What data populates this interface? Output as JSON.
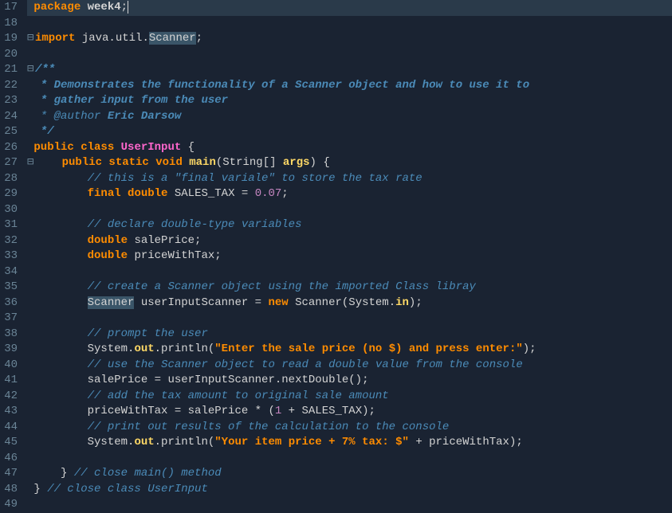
{
  "lineNumbers": [
    "17",
    "18",
    "19",
    "20",
    "21",
    "22",
    "23",
    "24",
    "25",
    "26",
    "27",
    "28",
    "29",
    "30",
    "31",
    "32",
    "33",
    "34",
    "35",
    "36",
    "37",
    "38",
    "39",
    "40",
    "41",
    "42",
    "43",
    "44",
    "45",
    "46",
    "47",
    "48",
    "49"
  ],
  "code": {
    "l17": {
      "kw": "package",
      "pkg": "week4",
      "semi": ";"
    },
    "l19": {
      "kw": "import",
      "pkg": "java.util.",
      "cls": "Scanner",
      "semi": ";"
    },
    "l21": {
      "c": "/**"
    },
    "l22": {
      "c": " * Demonstrates the functionality of a Scanner object and how to use it to"
    },
    "l23": {
      "c": " * gather input from the user"
    },
    "l24": {
      "tag": " * @author ",
      "name": "Eric Darsow"
    },
    "l25": {
      "c": " */"
    },
    "l26": {
      "a": "public ",
      "b": "class ",
      "cls": "UserInput",
      "brace": " {"
    },
    "l27": {
      "a": "public ",
      "b": "static ",
      "c": "void ",
      "m": "main",
      "p1": "(",
      "t": "String",
      "arr": "[] ",
      "arg": "args",
      "p2": ") {"
    },
    "l28": {
      "c": "// this is a \"final variale\" to store the tax rate"
    },
    "l29": {
      "a": "final ",
      "b": "double ",
      "v": "SALES_TAX = ",
      "n": "0.07",
      "s": ";"
    },
    "l31": {
      "c": "// declare double-type variables"
    },
    "l32": {
      "a": "double ",
      "v": "salePrice;"
    },
    "l33": {
      "a": "double ",
      "v": "priceWithTax;"
    },
    "l35": {
      "c": "// create a Scanner object using the imported Class libray"
    },
    "l36": {
      "cls": "Scanner",
      "v1": " userInputScanner = ",
      "kw": "new ",
      "v2": "Scanner(System.",
      "in": "in",
      "v3": ");"
    },
    "l38": {
      "c": "// prompt the user"
    },
    "l39": {
      "a": "System.",
      "out": "out",
      "b": ".println(",
      "str": "\"Enter the sale price (no $) and press enter:\"",
      "c": ");"
    },
    "l40": {
      "c": "// use the Scanner object to read a double value from the console"
    },
    "l41": {
      "v": "salePrice = userInputScanner.nextDouble();"
    },
    "l42": {
      "c": "// add the tax amount to original sale amount"
    },
    "l43": {
      "v": "priceWithTax = salePrice * (",
      "n": "1",
      "v2": " + SALES_TAX);"
    },
    "l44": {
      "c": "// print out results of the calculation to the console"
    },
    "l45": {
      "a": "System.",
      "out": "out",
      "b": ".println(",
      "str": "\"Your item price + 7% tax: $\"",
      "c": " + priceWithTax);"
    },
    "l47": {
      "brace": "} ",
      "c": "// close main() method"
    },
    "l48": {
      "brace": "} ",
      "c": "// close class UserInput"
    }
  }
}
